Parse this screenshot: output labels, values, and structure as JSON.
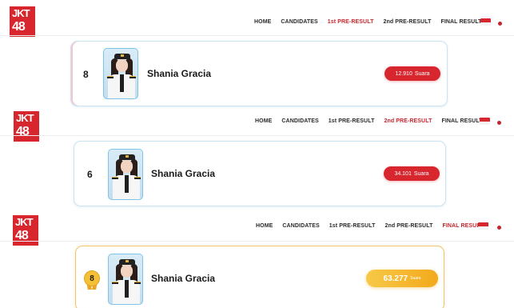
{
  "logo": {
    "line1": "JKT",
    "line2": "48"
  },
  "nav": {
    "items": [
      "HOME",
      "CANDIDATES",
      "1st PRE-RESULT",
      "2nd PRE-RESULT",
      "FINAL RESULT"
    ]
  },
  "sections": [
    {
      "active_tab": "1st PRE-RESULT",
      "rank": "8",
      "name": "Shania Gracia",
      "votes": "12.910",
      "votes_unit": "Suara"
    },
    {
      "active_tab": "2nd PRE-RESULT",
      "rank": "6",
      "name": "Shania Gracia",
      "votes": "34.101",
      "votes_unit": "Suara"
    },
    {
      "active_tab": "FINAL RESULT",
      "rank": "8",
      "name": "Shania Gracia",
      "votes": "63.277",
      "votes_unit": "Suara"
    }
  ],
  "colors": {
    "brand_red": "#d7262e",
    "active_nav": "#c4262e",
    "gold": "#f4c136",
    "card_border": "#c9e3f1"
  }
}
